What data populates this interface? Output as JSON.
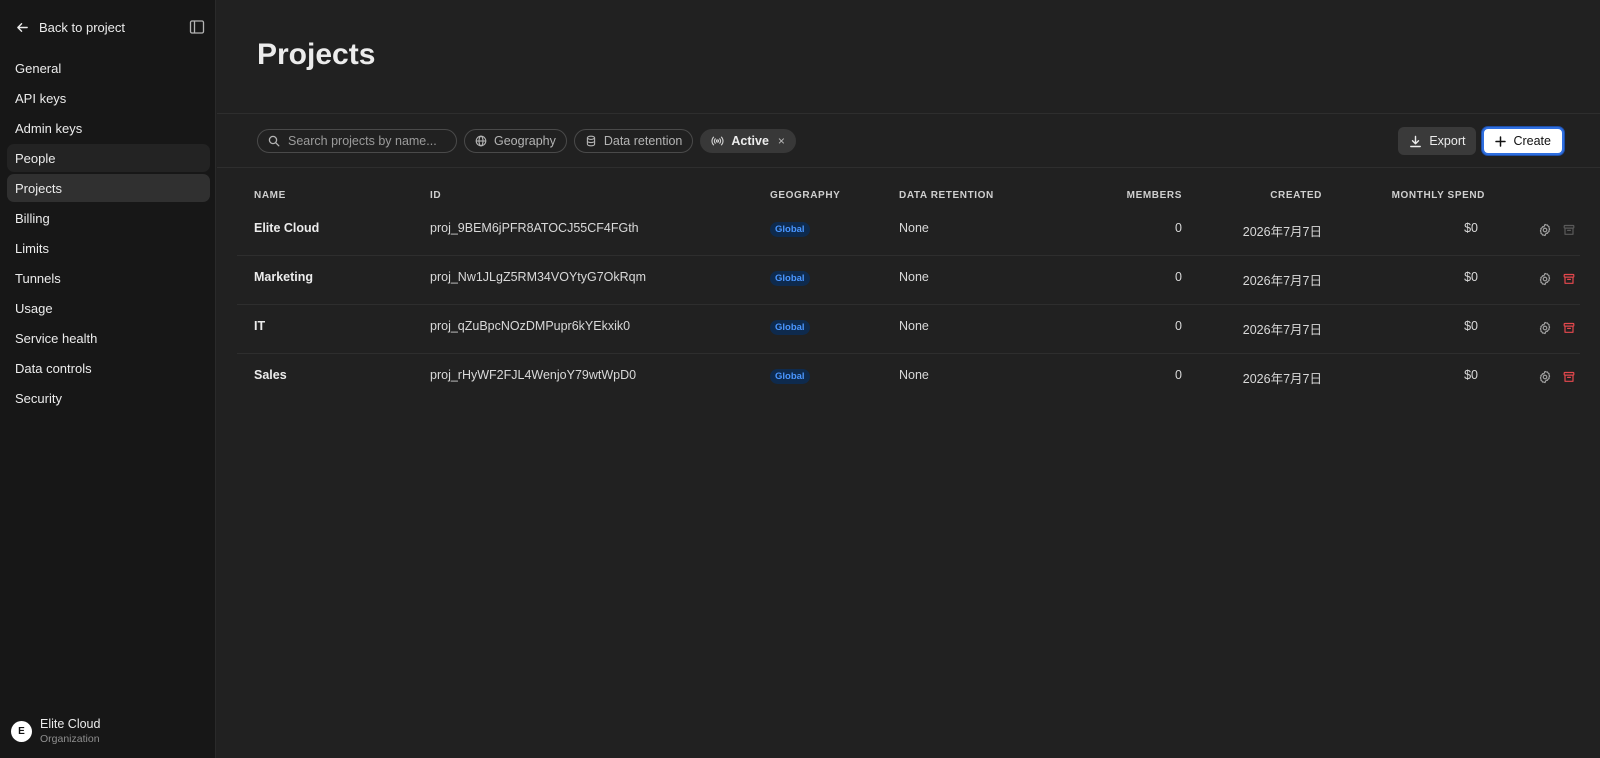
{
  "sidebar": {
    "back_label": "Back to project",
    "items": [
      {
        "label": "General"
      },
      {
        "label": "API keys"
      },
      {
        "label": "Admin keys"
      },
      {
        "label": "People"
      },
      {
        "label": "Projects"
      },
      {
        "label": "Billing"
      },
      {
        "label": "Limits"
      },
      {
        "label": "Tunnels"
      },
      {
        "label": "Usage"
      },
      {
        "label": "Service health"
      },
      {
        "label": "Data controls"
      },
      {
        "label": "Security"
      }
    ],
    "active_item": "Projects",
    "org": {
      "initial": "E",
      "name": "Elite Cloud",
      "subtitle": "Organization"
    }
  },
  "page": {
    "title": "Projects"
  },
  "toolbar": {
    "search_placeholder": "Search projects by name...",
    "filters": {
      "geography": "Geography",
      "data_retention": "Data retention",
      "status": "Active",
      "status_clear": "×"
    },
    "export_label": "Export",
    "create_label": "Create"
  },
  "table": {
    "headers": {
      "name": "NAME",
      "id": "ID",
      "geography": "GEOGRAPHY",
      "data_retention": "DATA RETENTION",
      "members": "MEMBERS",
      "created": "CREATED",
      "monthly_spend": "MONTHLY SPEND"
    },
    "rows": [
      {
        "name": "Elite Cloud",
        "id": "proj_9BEM6jPFR8ATOCJ55CF4FGth",
        "geography": "Global",
        "data_retention": "None",
        "members": "0",
        "created": "2026年7月7日",
        "monthly_spend": "$0",
        "archive_enabled": false
      },
      {
        "name": "Marketing",
        "id": "proj_Nw1JLgZ5RM34VOYtyG7OkRqm",
        "geography": "Global",
        "data_retention": "None",
        "members": "0",
        "created": "2026年7月7日",
        "monthly_spend": "$0",
        "archive_enabled": true
      },
      {
        "name": "IT",
        "id": "proj_qZuBpcNOzDMPupr6kYEkxik0",
        "geography": "Global",
        "data_retention": "None",
        "members": "0",
        "created": "2026年7月7日",
        "monthly_spend": "$0",
        "archive_enabled": true
      },
      {
        "name": "Sales",
        "id": "proj_rHyWF2FJL4WenjoY79wtWpD0",
        "geography": "Global",
        "data_retention": "None",
        "members": "0",
        "created": "2026年7月7日",
        "monthly_spend": "$0",
        "archive_enabled": true
      }
    ]
  },
  "colors": {
    "background": "#212121",
    "sidebar": "#171717",
    "badge_text": "#4a96ff",
    "archive_active": "#e5484d",
    "archive_disabled": "#5a5a5a",
    "create_focus": "#2f6fe0"
  },
  "icons": {
    "back": "arrow-left-icon",
    "collapse": "sidebar-toggle-icon",
    "search": "search-icon",
    "geography": "globe-icon",
    "data_retention": "database-icon",
    "status": "broadcast-icon",
    "export": "download-icon",
    "create": "plus-icon",
    "settings": "gear-icon",
    "archive": "archive-icon"
  }
}
